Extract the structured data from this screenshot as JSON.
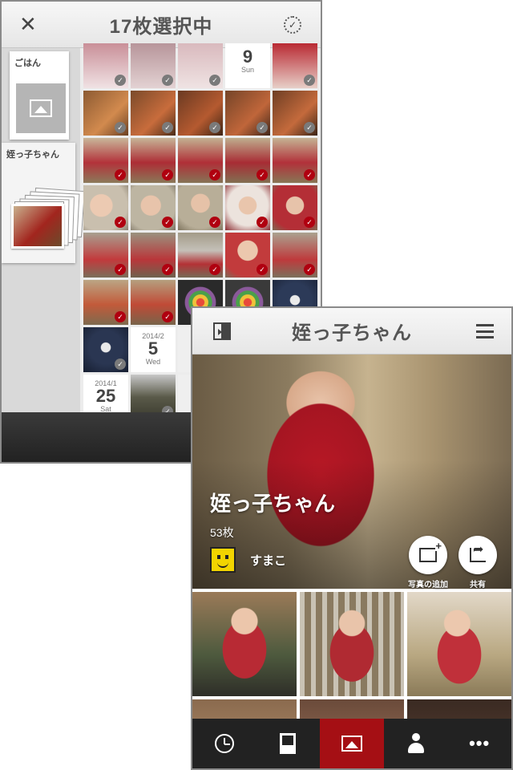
{
  "screen_select": {
    "title": "17枚選択中",
    "albums": [
      {
        "name": "ごはん"
      },
      {
        "name": "姪っ子ちゃん"
      }
    ],
    "date_cells": [
      {
        "year": "",
        "day": "9",
        "weekday": "Sun"
      },
      {
        "year": "2014/2",
        "day": "5",
        "weekday": "Wed"
      },
      {
        "year": "2014/1",
        "day": "25",
        "weekday": "Sat"
      }
    ],
    "colors": {
      "selected_check": "#b00010",
      "unselected_check": "#7a7a7a"
    }
  },
  "screen_album": {
    "title": "姪っ子ちゃん",
    "album_name": "姪っ子ちゃん",
    "photo_count": "53枚",
    "owner_name": "すまこ",
    "actions": [
      {
        "label": "写真の追加",
        "icon": "add-photo-icon"
      },
      {
        "label": "共有",
        "icon": "share-icon"
      }
    ],
    "tabs": [
      {
        "icon": "clock-icon"
      },
      {
        "icon": "album-icon"
      },
      {
        "icon": "photo-icon",
        "active": true
      },
      {
        "icon": "person-icon"
      },
      {
        "icon": "more-icon",
        "glyph": "•••"
      }
    ],
    "colors": {
      "accent": "#a50f14"
    }
  }
}
